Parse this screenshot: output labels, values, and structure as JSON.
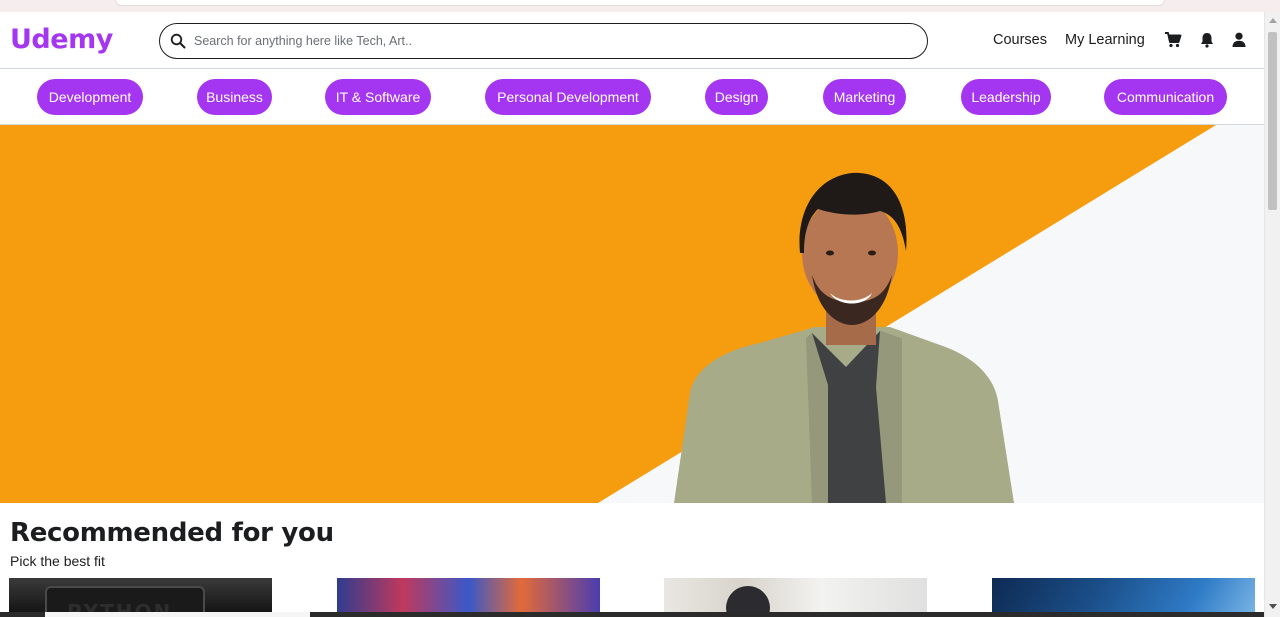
{
  "header": {
    "logo": "Udemy",
    "search_placeholder": "Search for anything here like Tech, Art..",
    "nav": [
      "Courses",
      "My Learning"
    ],
    "icons": [
      "cart-icon",
      "bell-icon",
      "user-icon"
    ]
  },
  "categories": [
    "Development",
    "Business",
    "IT & Software",
    "Personal Development",
    "Design",
    "Marketing",
    "Leadership",
    "Communication"
  ],
  "hero": {
    "background_color": "#f59d0f",
    "secondary_color": "#f7f8fa"
  },
  "recommended": {
    "title": "Recommended for you",
    "subtitle": "Pick the best fit",
    "card1_text": "PYTHON"
  },
  "colors": {
    "brand": "#a435f0",
    "text": "#1c1d1f"
  }
}
